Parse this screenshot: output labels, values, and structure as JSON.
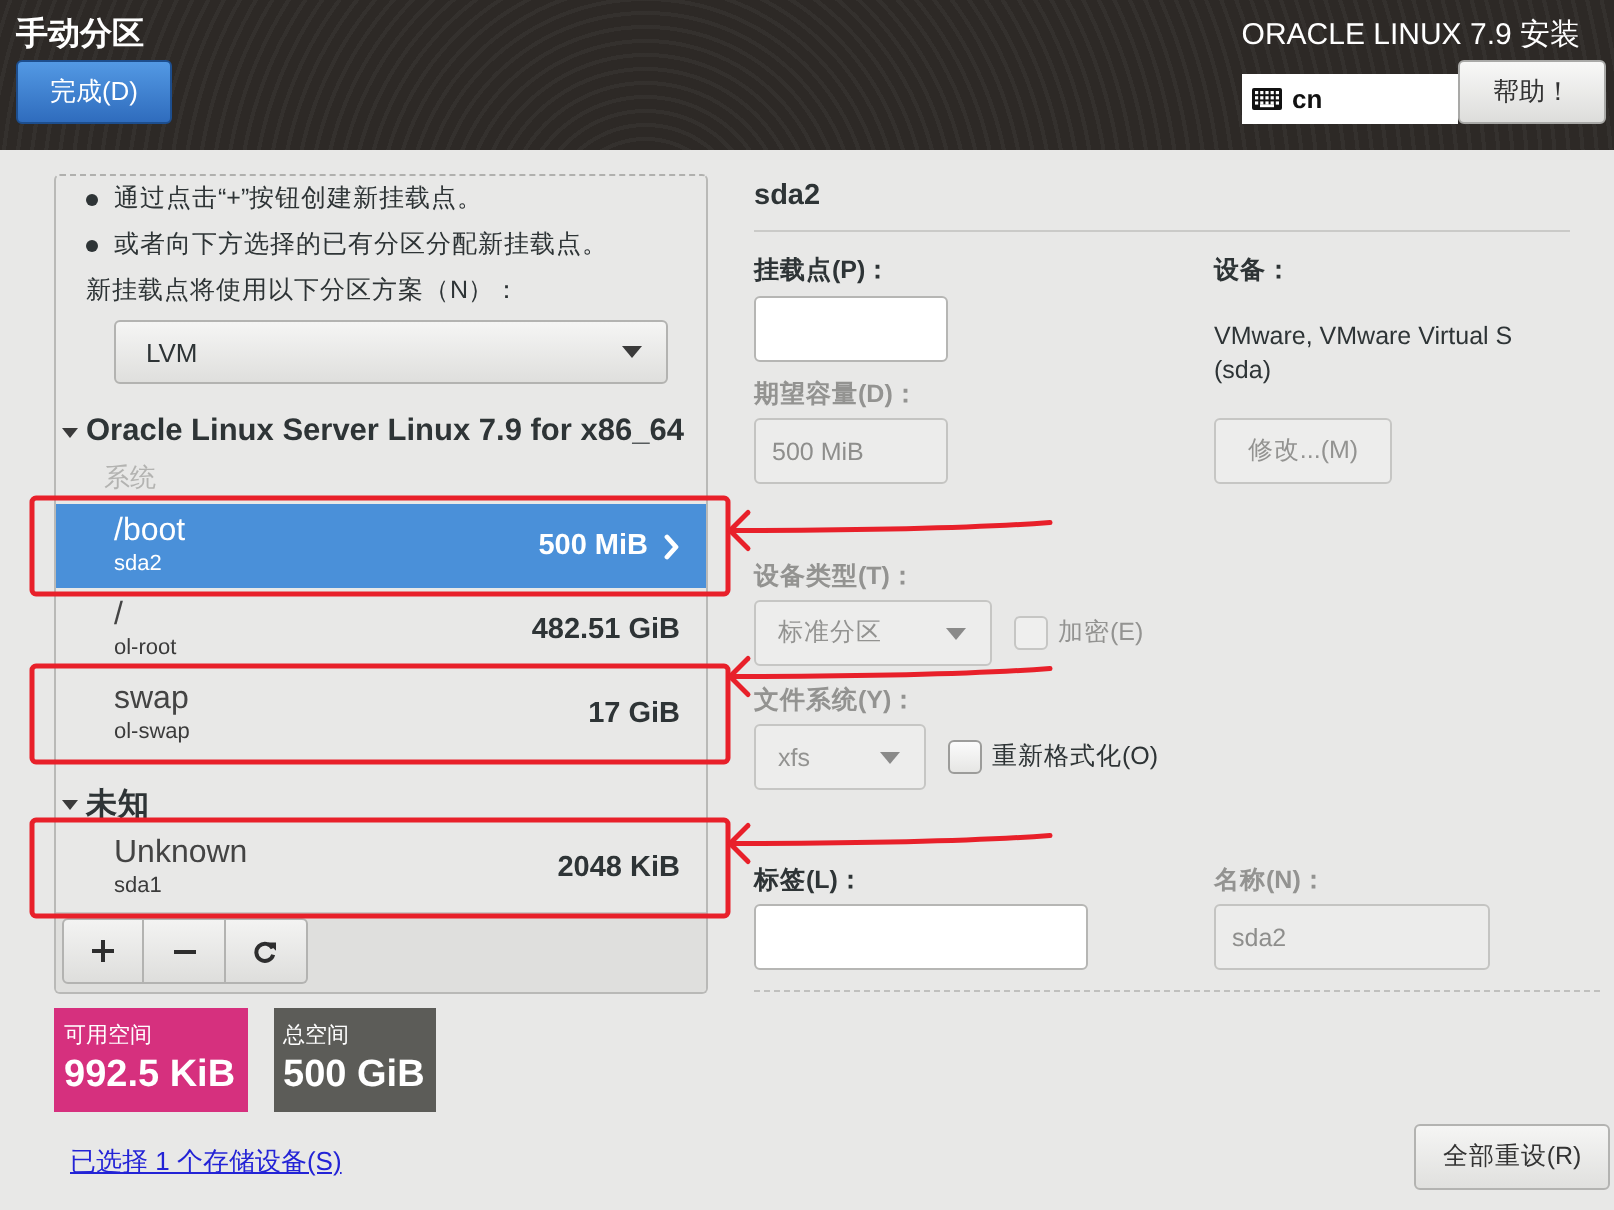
{
  "header": {
    "title": "手动分区",
    "done_button": "完成(D)",
    "product": "ORACLE LINUX 7.9 安装",
    "keyboard_layout": "cn",
    "help_button": "帮助！"
  },
  "partitions": {
    "hints": [
      "通过点击“+”按钮创建新挂载点。",
      "或者向下方选择的已有分区分配新挂载点。"
    ],
    "scheme_label": "新挂载点将使用以下分区方案（N）：",
    "scheme": "LVM",
    "groups": [
      {
        "title": "Oracle Linux Server Linux 7.9 for x86_64",
        "expanded": true,
        "sections": [
          {
            "title": "系统",
            "rows": [
              {
                "mount_point": "/boot",
                "device": "sda2",
                "size": "500 MiB",
                "selected": true,
                "annotated": true
              },
              {
                "mount_point": "/",
                "device": "ol-root",
                "size": "482.51 GiB",
                "selected": false,
                "annotated": false
              },
              {
                "mount_point": "swap",
                "device": "ol-swap",
                "size": "17 GiB",
                "selected": false,
                "annotated": true
              }
            ]
          }
        ]
      },
      {
        "title": "未知",
        "expanded": true,
        "sections": [
          {
            "rows": [
              {
                "mount_point": "Unknown",
                "device": "sda1",
                "size": "2048 KiB",
                "selected": false,
                "annotated": true
              }
            ]
          }
        ]
      }
    ],
    "toolbar": [
      {
        "kind": "add"
      },
      {
        "kind": "remove"
      },
      {
        "kind": "refresh"
      }
    ]
  },
  "space": [
    {
      "kind": "available",
      "label": "可用空间",
      "value": "992.5 KiB"
    },
    {
      "kind": "total",
      "label": "总空间",
      "value": "500 GiB"
    }
  ],
  "storage_link": "已选择 1 个存储设备(S)",
  "details": {
    "title": "sda2",
    "mount_point": {
      "label": "挂载点(P)：",
      "disabled": false
    },
    "capacity": {
      "label": "期望容量(D)：",
      "value": "500 MiB",
      "disabled": true
    },
    "device": {
      "label": "设备：",
      "description": "VMware, VMware Virtual S (sda)"
    },
    "modify_button": {
      "label": "修改...(M)",
      "disabled": true
    },
    "device_type": {
      "label": "设备类型(T)：",
      "value": "标准分区",
      "disabled": true
    },
    "encrypt": {
      "label": "加密(E)",
      "checked": false,
      "disabled": true
    },
    "file_system": {
      "label": "文件系统(Y)：",
      "value": "xfs",
      "disabled": true
    },
    "reformat": {
      "label": "重新格式化(O)",
      "checked": false,
      "disabled": false
    },
    "label_field": {
      "label": "标签(L)：",
      "disabled": false
    },
    "name": {
      "label": "名称(N)：",
      "value": "sda2",
      "disabled": true
    },
    "reset_button": "全部重设(R)"
  }
}
